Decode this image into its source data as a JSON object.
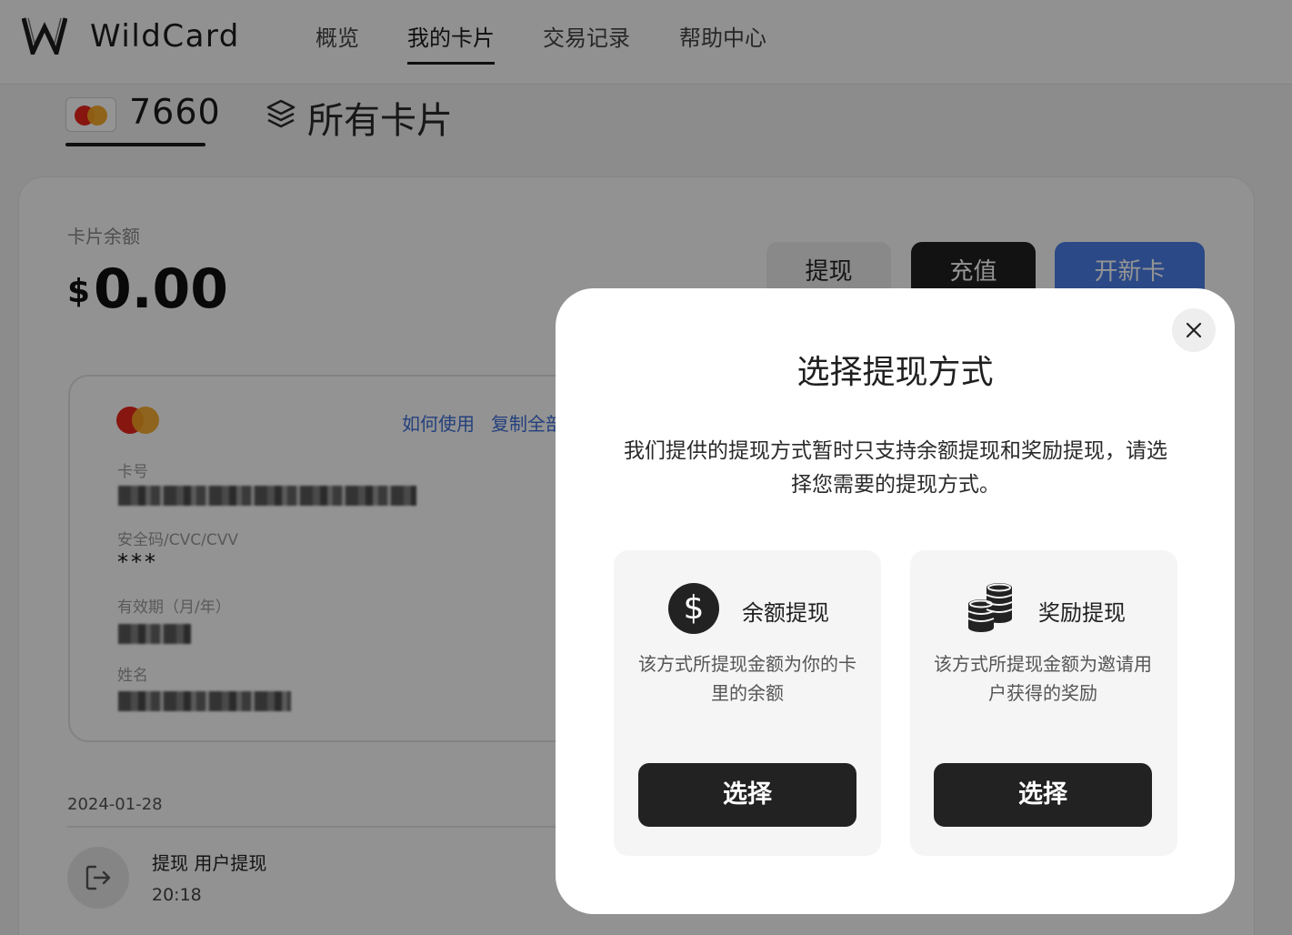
{
  "app": {
    "name": "WildCard"
  },
  "nav": {
    "items": [
      {
        "label": "概览"
      },
      {
        "label": "我的卡片"
      },
      {
        "label": "交易记录"
      },
      {
        "label": "帮助中心"
      }
    ],
    "active": "我的卡片"
  },
  "cards": {
    "selected_last4": "7660",
    "all_cards_label": "所有卡片"
  },
  "balance": {
    "label": "卡片余额",
    "currency_symbol": "$",
    "amount": "0.00"
  },
  "actions": {
    "withdraw": "提现",
    "recharge": "充值",
    "new_card": "开新卡"
  },
  "card_details": {
    "how_to_use": "如何使用",
    "copy_all": "复制全部",
    "number_label": "卡号",
    "cvv_label": "安全码/CVC/CVV",
    "cvv_value": "***",
    "expiry_label": "有效期（月/年）",
    "name_label": "姓名"
  },
  "transactions": {
    "date": "2024-01-28",
    "items": [
      {
        "title": "提现 用户提现",
        "time": "20:18"
      }
    ]
  },
  "modal": {
    "title": "选择提现方式",
    "description": "我们提供的提现方式暂时只支持余额提现和奖励提现，请选择您需要的提现方式。",
    "options": [
      {
        "icon": "dollar-icon",
        "title": "余额提现",
        "description": "该方式所提现金额为你的卡里的余额",
        "button": "选择"
      },
      {
        "icon": "coins-icon",
        "title": "奖励提现",
        "description": "该方式所提现金额为邀请用户获得的奖励",
        "button": "选择"
      }
    ]
  },
  "colors": {
    "primary_dark": "#222222",
    "accent_blue": "#4a7fe8",
    "link_blue": "#3f6fd8",
    "mastercard_red": "#e8261c",
    "mastercard_orange": "#f5a623"
  }
}
